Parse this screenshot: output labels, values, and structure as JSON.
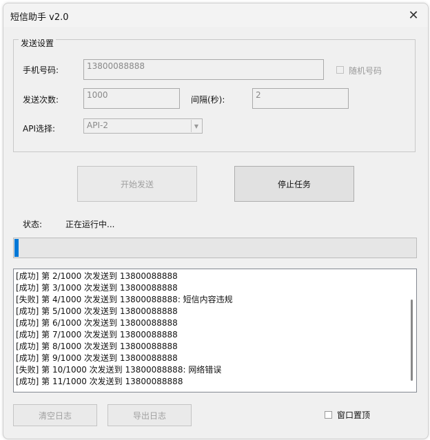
{
  "window": {
    "title": "短信助手 v2.0",
    "close_glyph": "✕"
  },
  "settings": {
    "group_label": "发送设置",
    "phone_label": "手机号码:",
    "phone_value": "13800088888",
    "random_label": "随机号码",
    "random_checked": false,
    "count_label": "发送次数:",
    "count_value": "1000",
    "interval_label": "间隔(秒):",
    "interval_value": "2",
    "api_label": "API选择:",
    "api_value": "API-2"
  },
  "actions": {
    "start_label": "开始发送",
    "stop_label": "停止任务"
  },
  "status": {
    "label": "状态:",
    "value": "正在运行中..."
  },
  "progress": {
    "fraction": 0.011
  },
  "log": [
    "[成功] 第 2/1000 次发送到 13800088888",
    "[成功] 第 3/1000 次发送到 13800088888",
    "[失败] 第 4/1000 次发送到 13800088888: 短信内容违规",
    "[成功] 第 5/1000 次发送到 13800088888",
    "[成功] 第 6/1000 次发送到 13800088888",
    "[成功] 第 7/1000 次发送到 13800088888",
    "[成功] 第 8/1000 次发送到 13800088888",
    "[成功] 第 9/1000 次发送到 13800088888",
    "[失败] 第 10/1000 次发送到 13800088888: 网络错误",
    "[成功] 第 11/1000 次发送到 13800088888"
  ],
  "footer": {
    "clear_label": "清空日志",
    "export_label": "导出日志",
    "topmost_label": "窗口置顶",
    "topmost_checked": false
  },
  "colors": {
    "progress_fill": "#0078d7"
  }
}
